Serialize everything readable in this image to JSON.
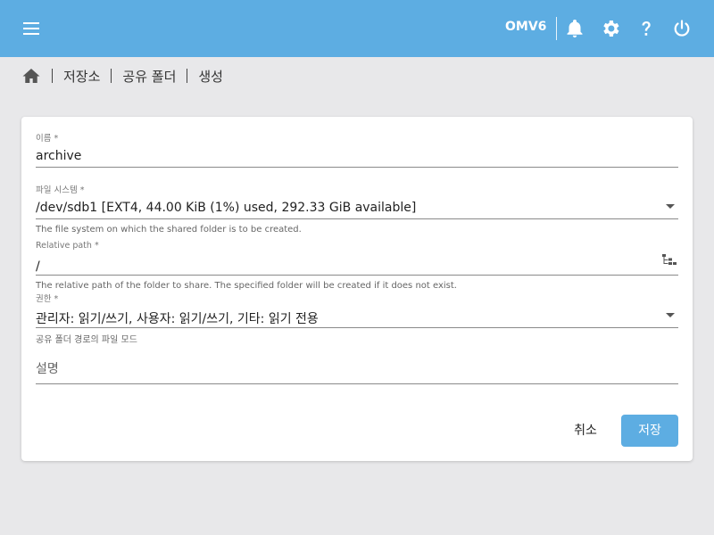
{
  "topbar": {
    "host": "OMV6",
    "icons": [
      "menu-icon",
      "bell-icon",
      "gear-icon",
      "help-icon",
      "power-icon"
    ],
    "color": "#5dade2"
  },
  "breadcrumb": {
    "items": [
      "저장소",
      "공유 폴더",
      "생성"
    ]
  },
  "form": {
    "name": {
      "label": "이름 *",
      "value": "archive"
    },
    "filesystem": {
      "label": "파일 시스템 *",
      "value": "/dev/sdb1 [EXT4, 44.00 KiB (1%) used, 292.33 GiB available]",
      "hint": "The file system on which the shared folder is to be created."
    },
    "relpath": {
      "label": "Relative path *",
      "value": "/",
      "hint": "The relative path of the folder to share. The specified folder will be created if it does not exist."
    },
    "permissions": {
      "label": "권한 *",
      "value": "관리자: 읽기/쓰기, 사용자: 읽기/쓰기, 기타: 읽기 전용",
      "hint": "공유 폴더 경로의 파일 모드"
    },
    "description": {
      "placeholder": "설명"
    }
  },
  "actions": {
    "cancel": "취소",
    "save": "저장"
  }
}
